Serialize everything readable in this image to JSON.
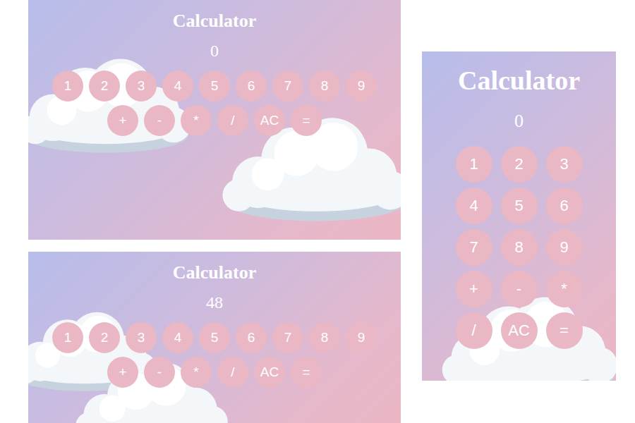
{
  "screenshots": [
    {
      "kind": "wide",
      "title": "Calculator",
      "display": "0",
      "key_rows": [
        [
          "1",
          "2",
          "3",
          "4",
          "5",
          "6",
          "7",
          "8",
          "9"
        ],
        [
          "+",
          "-",
          "*",
          "/",
          "AC",
          "="
        ]
      ]
    },
    {
      "kind": "wide",
      "title": "Calculator",
      "display": "48",
      "key_rows": [
        [
          "1",
          "2",
          "3",
          "4",
          "5",
          "6",
          "7",
          "8",
          "9"
        ],
        [
          "+",
          "-",
          "*",
          "/",
          "AC",
          "="
        ]
      ]
    },
    {
      "kind": "narrow",
      "title": "Calculator",
      "display": "0",
      "key_rows": [
        [
          "1",
          "2",
          "3"
        ],
        [
          "4",
          "5",
          "6"
        ],
        [
          "7",
          "8",
          "9"
        ],
        [
          "+",
          "-",
          "*"
        ],
        [
          "/",
          "AC",
          "="
        ]
      ]
    }
  ]
}
